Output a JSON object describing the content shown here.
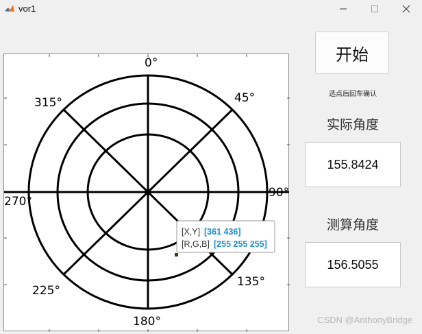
{
  "window": {
    "title": "vor1"
  },
  "polar_plot": {
    "angle_labels": [
      "0°",
      "45°",
      "90°",
      "135°",
      "180°",
      "225°",
      "270°",
      "315°"
    ]
  },
  "datatip": {
    "xy_label": "[X,Y]",
    "xy_value": "[361 436]",
    "rgb_label": "[R,G,B]",
    "rgb_value": "[255 255 255]"
  },
  "controls": {
    "start_label": "开始",
    "hint": "选点后回车确认",
    "actual_label": "实际角度",
    "actual_value": "155.8424",
    "measured_label": "测算角度",
    "measured_value": "156.5055"
  },
  "watermark": "CSDN @AnthonyBridge",
  "colors": {
    "datatip_value": "#1e8fd4",
    "plot_stroke": "#000000"
  }
}
